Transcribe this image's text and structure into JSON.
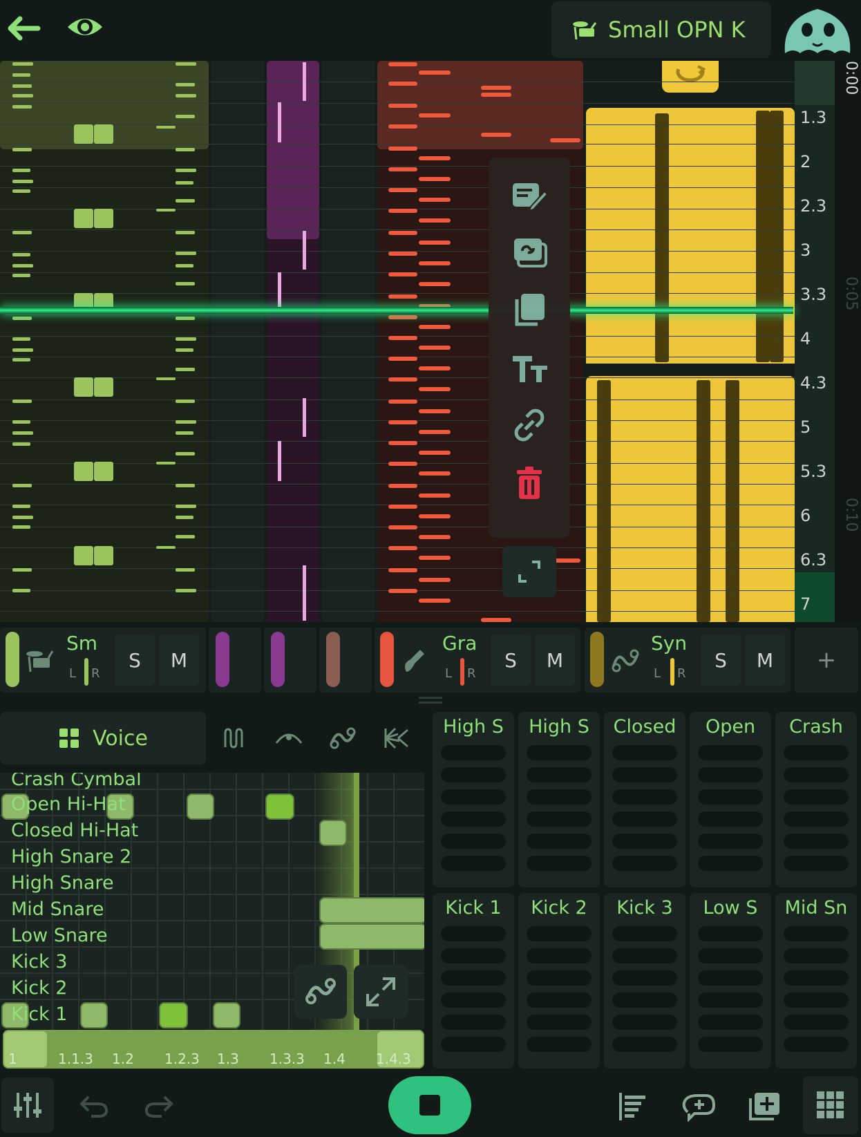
{
  "header": {
    "instrument_name": "Small OPN K",
    "icons": [
      "back-arrow-icon",
      "eye-icon",
      "drum-kit-icon",
      "mascot-avatar"
    ]
  },
  "ruler": {
    "bar_labels": [
      "1.3",
      "2",
      "2.3",
      "3",
      "3.3",
      "4",
      "4.3",
      "5",
      "5.3",
      "6",
      "6.3",
      "7"
    ],
    "time_labels": [
      "0:00",
      "0:05",
      "0:10"
    ]
  },
  "context_menu": {
    "items": [
      "edit-clip-icon",
      "link-copy-icon",
      "duplicate-icon",
      "rename-text-icon",
      "link-icon",
      "delete-icon"
    ],
    "delete_color": "#e8324a",
    "expand_icon": "expand-icon"
  },
  "tracks": [
    {
      "name": "Sm",
      "color": "#9bc45e",
      "icon": "drum-kit-icon",
      "solo": "S",
      "mute": "M",
      "pan_l": "L",
      "pan_r": "R"
    },
    {
      "name": "",
      "color": "#8a3a8f"
    },
    {
      "name": "",
      "color": "#8a3a8f"
    },
    {
      "name": "",
      "color": "#8c5e52"
    },
    {
      "name": "Gra",
      "color": "#e8553e",
      "icon": "guitar-icon",
      "solo": "S",
      "mute": "M",
      "pan_l": "L",
      "pan_r": "R"
    },
    {
      "name": "Syn",
      "color": "#8e7a1e",
      "icon": "synth-wave-icon",
      "solo": "S",
      "mute": "M",
      "pan_l": "L",
      "pan_r": "R"
    }
  ],
  "add_track_label": "+",
  "drum_editor": {
    "voice_label": "Voice",
    "tool_icons": [
      "waveform-icon",
      "envelope-icon",
      "automation-icon",
      "effects-icon"
    ],
    "rows": [
      "Crash Cymbal",
      "Open Hi-Hat",
      "Closed Hi-Hat",
      "High Snare 2",
      "High Snare",
      "Mid Snare",
      "Low Snare",
      "Kick 3",
      "Kick 2",
      "Kick 1"
    ],
    "timeline_labels": [
      "1",
      "1.1.3",
      "1.2",
      "1.2.3",
      "1.3",
      "1.3.3",
      "1.4",
      "1.4.3"
    ]
  },
  "pads": {
    "top": [
      "High S",
      "High S",
      "Closed",
      "Open",
      "Crash"
    ],
    "bottom": [
      "Kick 1",
      "Kick 2",
      "Kick 3",
      "Low S",
      "Mid Sn"
    ]
  },
  "bottom_bar": {
    "icons": [
      "mixer-icon",
      "undo-icon",
      "redo-icon",
      "stop-icon",
      "arrangement-icon",
      "loop-add-icon",
      "add-clip-icon",
      "grid-icon"
    ],
    "accent": "#2ec27e"
  }
}
